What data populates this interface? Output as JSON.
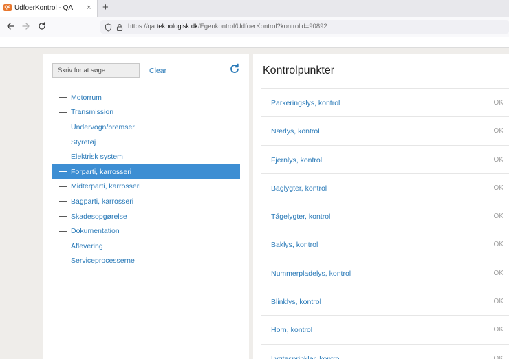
{
  "browser": {
    "tab_title": "UdfoerKontrol - QA",
    "tab_favicon": "QA",
    "tab_close": "×",
    "new_tab": "+",
    "url_prefix": "https://qa.",
    "url_domain": "teknologisk.dk",
    "url_path": "/Egenkontrol/UdfoerKontrol?kontrolid=90892"
  },
  "sidebar": {
    "search_placeholder": "Skriv for at søge...",
    "clear_label": "Clear",
    "items": [
      {
        "label": "Motorrum"
      },
      {
        "label": "Transmission"
      },
      {
        "label": "Undervogn/bremser"
      },
      {
        "label": "Styretøj"
      },
      {
        "label": "Elektrisk system"
      },
      {
        "label": "Forparti, karrosseri",
        "selected": true
      },
      {
        "label": "Midterparti, karrosseri"
      },
      {
        "label": "Bagparti, karrosseri"
      },
      {
        "label": "Skadesopgørelse"
      },
      {
        "label": "Dokumentation"
      },
      {
        "label": "Aflevering"
      },
      {
        "label": "Serviceprocesserne"
      }
    ]
  },
  "main": {
    "title": "Kontrolpunkter",
    "items": [
      {
        "label": "Parkeringslys, kontrol",
        "status": "OK"
      },
      {
        "label": "Nærlys, kontrol",
        "status": "OK"
      },
      {
        "label": "Fjernlys, kontrol",
        "status": "OK"
      },
      {
        "label": "Baglygter, kontrol",
        "status": "OK"
      },
      {
        "label": "Tågelygter, kontrol",
        "status": "OK"
      },
      {
        "label": "Baklys, kontrol",
        "status": "OK"
      },
      {
        "label": "Nummerpladelys, kontrol",
        "status": "OK"
      },
      {
        "label": "Blinklys, kontrol",
        "status": "OK"
      },
      {
        "label": "Horn, kontrol",
        "status": "OK"
      },
      {
        "label": "Lygtesprinkler, kontrol",
        "status": "OK"
      }
    ]
  },
  "colors": {
    "accent": "#3d8ed3",
    "link": "#2a7ab8",
    "status": "#a0a0a0"
  }
}
